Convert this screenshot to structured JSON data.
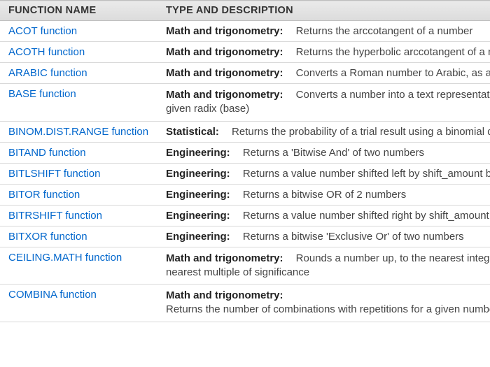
{
  "headers": {
    "name": "FUNCTION NAME",
    "desc": "TYPE AND DESCRIPTION"
  },
  "rows": [
    {
      "fn": "ACOT function",
      "cat": "Math and trigonometry:",
      "desc": "Returns the arccotangent of a number"
    },
    {
      "fn": "ACOTH function",
      "cat": "Math and trigonometry:",
      "desc": "Returns the hyperbolic arccotangent of a number"
    },
    {
      "fn": "ARABIC function",
      "cat": "Math and trigonometry:",
      "desc": "Converts a Roman number to Arabic, as a number"
    },
    {
      "fn": "BASE function",
      "cat": "Math and trigonometry:",
      "desc": "Converts a number into a text representation with the",
      "desc2": "given radix (base)"
    },
    {
      "fn": "BINOM.DIST.RANGE function",
      "cat": "Statistical:",
      "desc": "Returns the probability of a trial result using a binomial distribution"
    },
    {
      "fn": "BITAND function",
      "cat": "Engineering:",
      "desc": "Returns a 'Bitwise And' of two numbers"
    },
    {
      "fn": "BITLSHIFT function",
      "cat": "Engineering:",
      "desc": "Returns a value number shifted left by shift_amount bits"
    },
    {
      "fn": "BITOR function",
      "cat": "Engineering:",
      "desc": "Returns a bitwise OR of 2 numbers"
    },
    {
      "fn": "BITRSHIFT function",
      "cat": "Engineering:",
      "desc": "Returns a value number shifted right by shift_amount bits"
    },
    {
      "fn": "BITXOR function",
      "cat": "Engineering:",
      "desc": "Returns a bitwise 'Exclusive Or' of two numbers"
    },
    {
      "fn": "CEILING.MATH function",
      "cat": "Math and trigonometry:",
      "desc": "Rounds a number up, to the nearest integer or to the",
      "desc2": "nearest multiple of significance"
    },
    {
      "fn": "COMBINA function",
      "cat": "Math and trigonometry:",
      "desc": "",
      "desc2": "Returns the number of combinations with repetitions for a given number of items"
    }
  ]
}
